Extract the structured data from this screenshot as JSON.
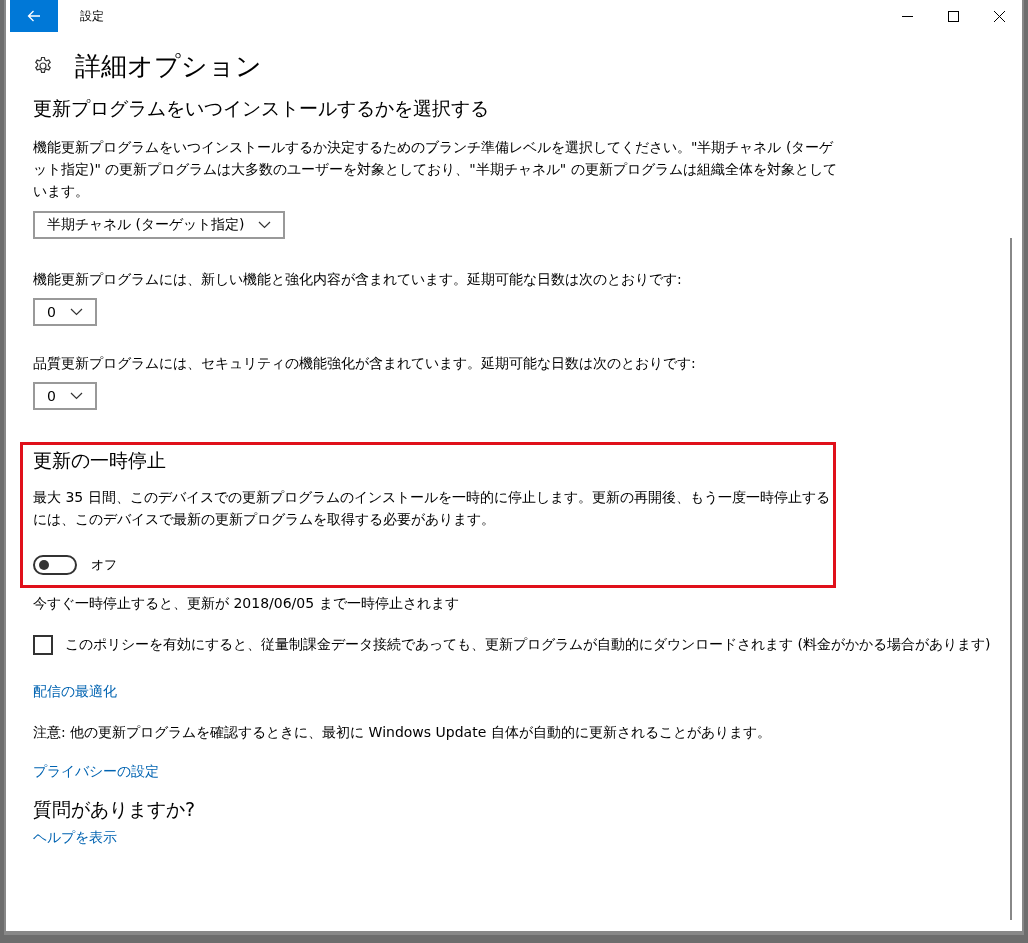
{
  "window": {
    "title": "設定"
  },
  "page_title": "詳細オプション",
  "branch": {
    "heading": "更新プログラムをいつインストールするかを選択する",
    "description": "機能更新プログラムをいつインストールするか決定するためのブランチ準備レベルを選択してください。\"半期チャネル (ターゲット指定)\" の更新プログラムは大多数のユーザーを対象としており、\"半期チャネル\" の更新プログラムは組織全体を対象としています。",
    "dropdown": {
      "value": "半期チャネル (ターゲット指定)"
    }
  },
  "deferrals": [
    {
      "label": "機能更新プログラムには、新しい機能と強化内容が含まれています。延期可能な日数は次のとおりです:",
      "dropdown": {
        "value": "0"
      }
    },
    {
      "label": "品質更新プログラムには、セキュリティの機能強化が含まれています。延期可能な日数は次のとおりです:",
      "dropdown": {
        "value": "0"
      }
    }
  ],
  "pause": {
    "highlighted": true,
    "heading": "更新の一時停止",
    "description": "最大 35 日間、このデバイスでの更新プログラムのインストールを一時的に停止します。更新の再開後、もう一度一時停止するには、このデバイスで最新の更新プログラムを取得する必要があります。",
    "toggle": {
      "on": false,
      "label": "オフ"
    }
  },
  "pause_note": "今すぐ一時停止すると、更新が 2018/06/05 まで一時停止されます",
  "metered": {
    "checked": false,
    "label": "このポリシーを有効にすると、従量制課金データ接続であっても、更新プログラムが自動的にダウンロードされます (料金がかかる場合があります)"
  },
  "delivery_link": "配信の最適化",
  "note": "注意: 他の更新プログラムを確認するときに、最初に Windows Update 自体が自動的に更新されることがあります。",
  "privacy_link": "プライバシーの設定",
  "help": {
    "heading": "質問がありますか?",
    "link": "ヘルプを表示"
  }
}
